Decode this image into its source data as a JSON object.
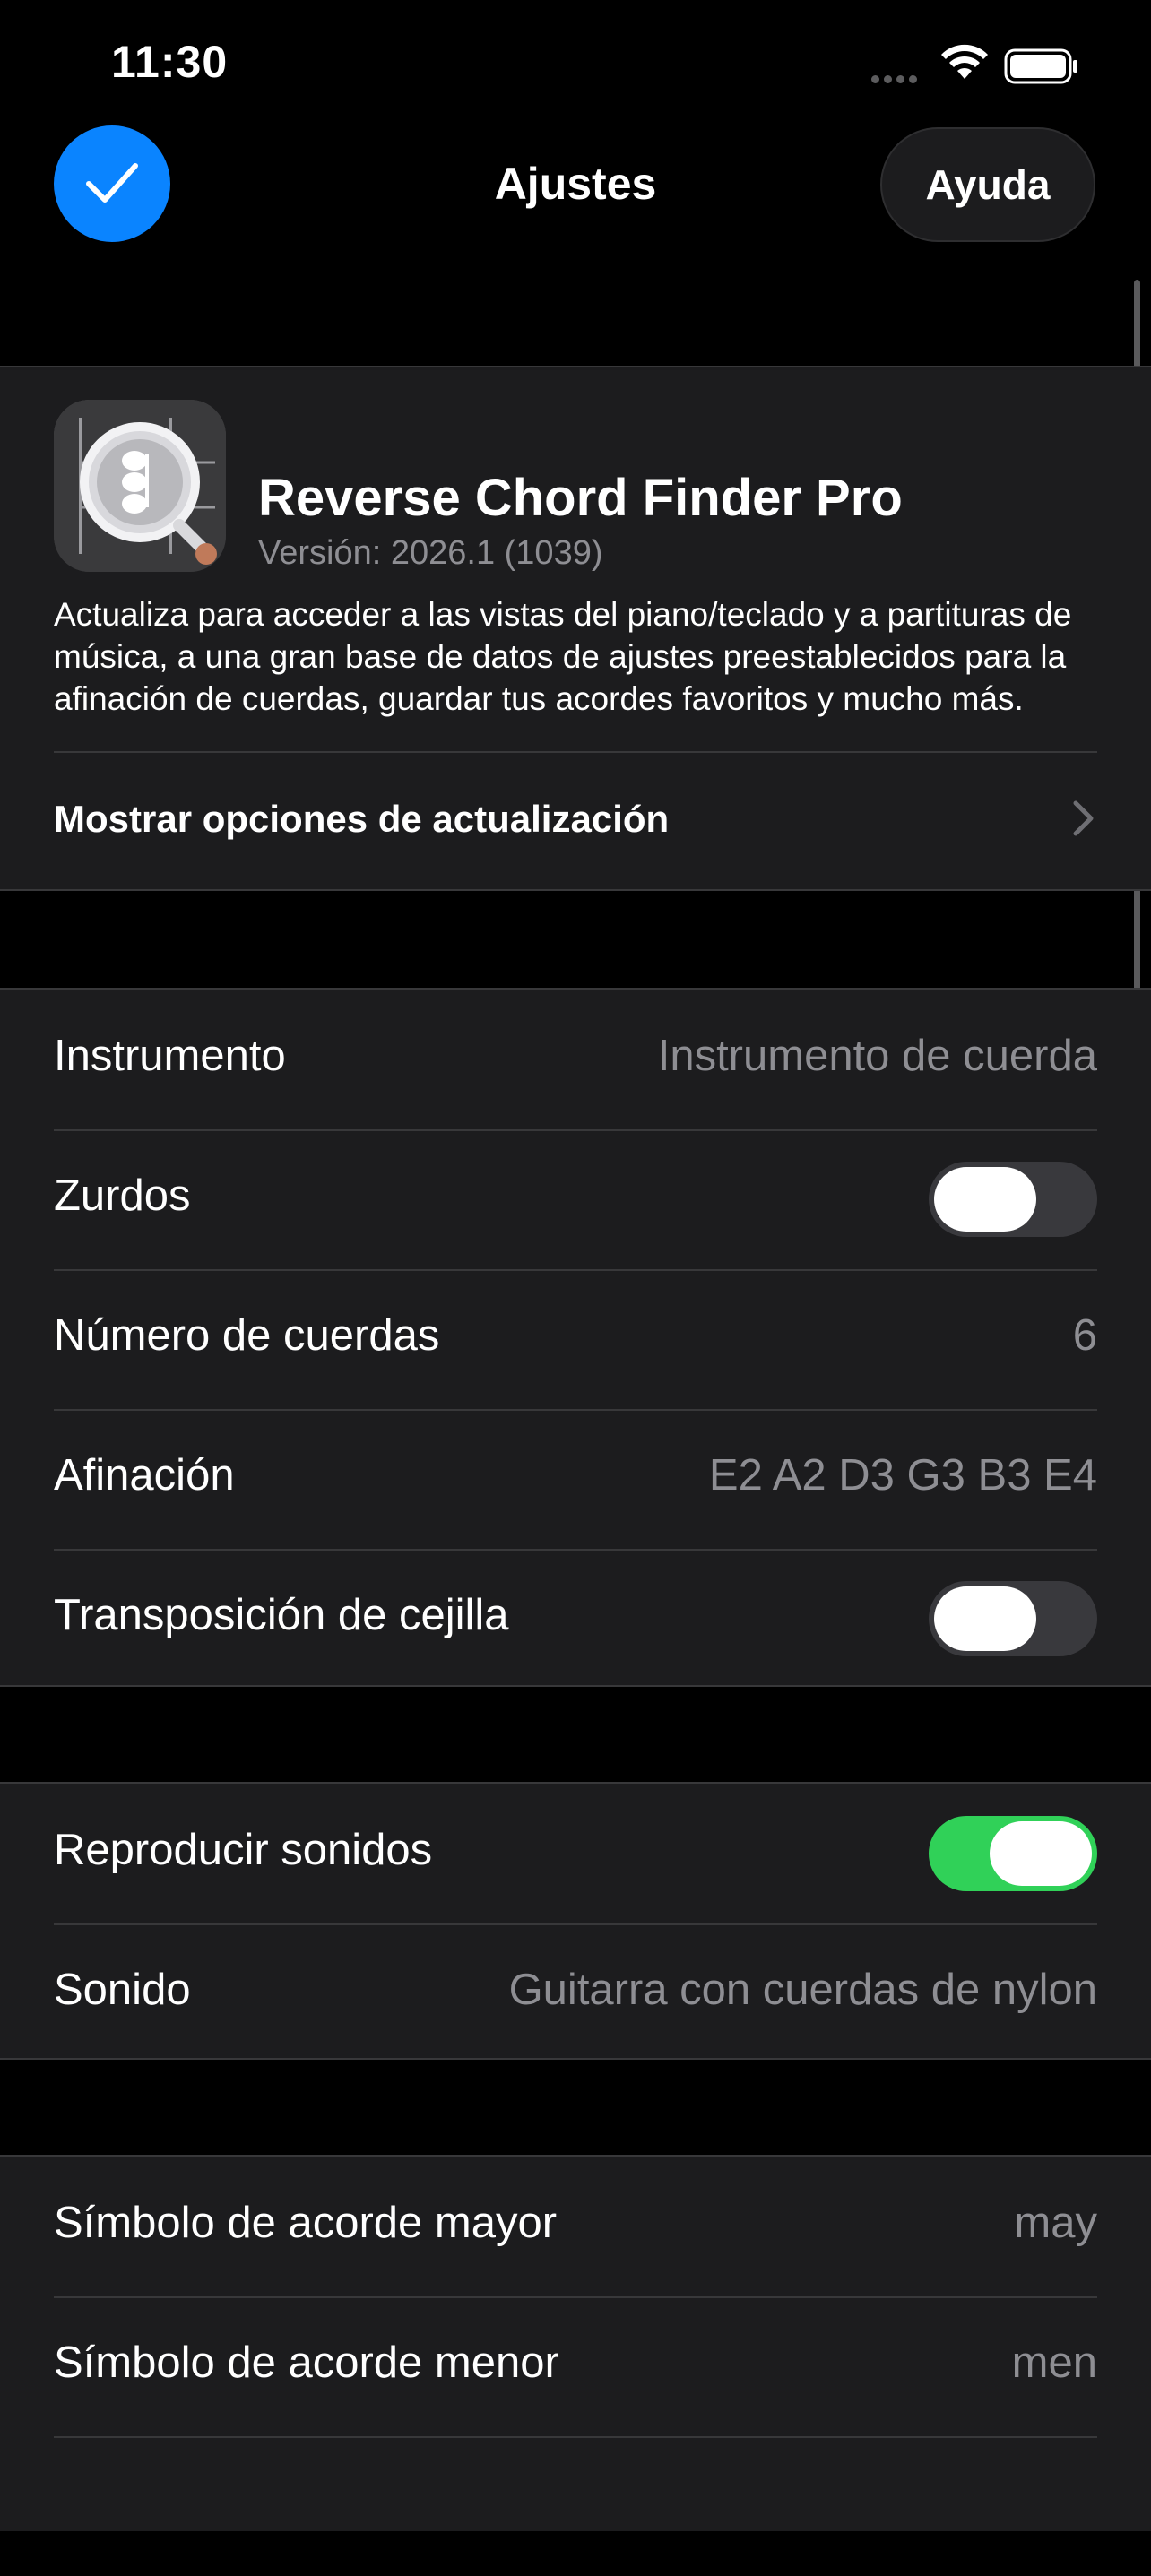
{
  "status_bar": {
    "time": "11:30"
  },
  "nav": {
    "title": "Ajustes",
    "help_label": "Ayuda"
  },
  "app_card": {
    "name": "Reverse Chord Finder Pro",
    "version": "Versión: 2026.1 (1039)",
    "description": "Actualiza para acceder a las vistas del piano/teclado y a partituras de música, a una gran base de datos de ajustes preestablecidos para la afinación de cuerdas, guardar tus acordes favoritos y mucho más.",
    "upgrade_options_label": "Mostrar opciones de actualización"
  },
  "instrument_section": {
    "instrument": {
      "label": "Instrumento",
      "value": "Instrumento de cuerda"
    },
    "left_handed": {
      "label": "Zurdos",
      "on": false
    },
    "string_count": {
      "label": "Número de cuerdas",
      "value": "6"
    },
    "tuning": {
      "label": "Afinación",
      "value": "E2 A2 D3 G3 B3 E4"
    },
    "capo": {
      "label": "Transposición de cejilla",
      "on": false
    }
  },
  "sound_section": {
    "play_sounds": {
      "label": "Reproducir sonidos",
      "on": true
    },
    "sound": {
      "label": "Sonido",
      "value": "Guitarra con cuerdas de nylon"
    }
  },
  "symbols_section": {
    "major": {
      "label": "Símbolo de acorde mayor",
      "value": "may"
    },
    "minor": {
      "label": "Símbolo de acorde menor",
      "value": "men"
    }
  },
  "colors": {
    "accent": "#0a84ff",
    "toggle_on": "#30d158",
    "cell_bg": "#1c1c1e"
  }
}
